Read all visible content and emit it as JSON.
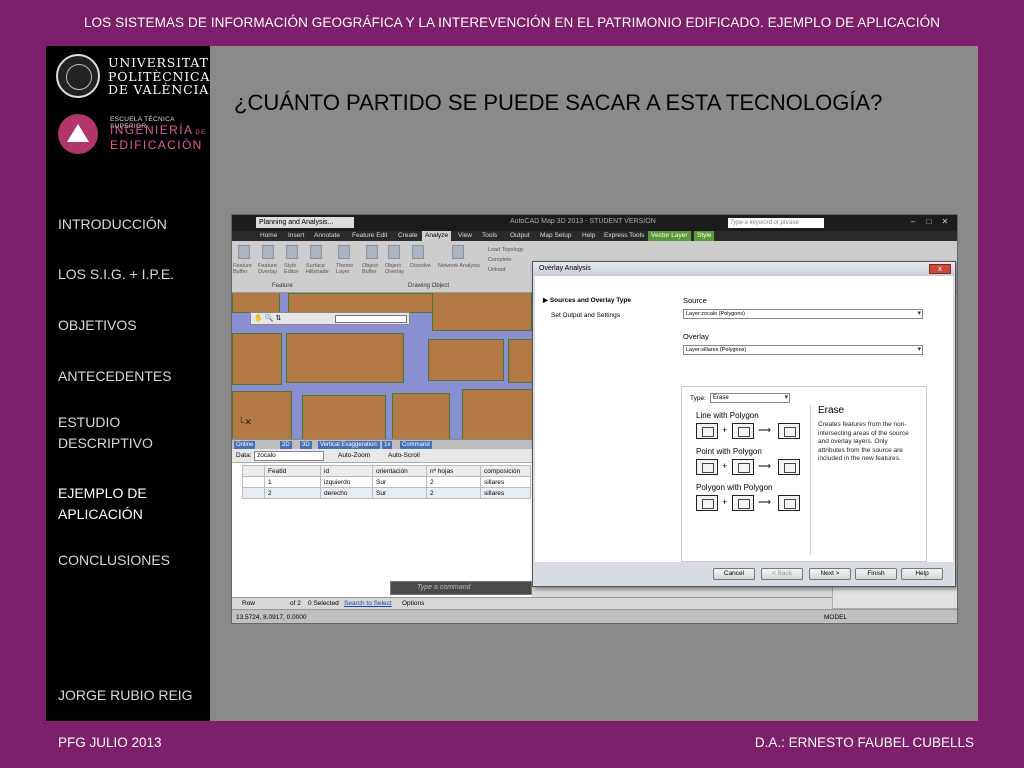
{
  "header": {
    "title": "LOS SISTEMAS DE INFORMACIÓN GEOGRÁFICA Y LA INTEREVENCIÓN EN EL PATRIMONIO EDIFICADO. EJEMPLO DE APLICACIÓN"
  },
  "footer": {
    "left": "PFG JULIO 2013",
    "right": "D.A.: ERNESTO FAUBEL CUBELLS"
  },
  "logos": {
    "university": [
      "UNIVERSITAT",
      "POLITÈCNICA",
      "DE VALÈNCIA"
    ],
    "school_small": "ESCUELA TÉCNICA SUPERIOR",
    "school_big": [
      "INGENIERÍA",
      "EDIFICACIÓN"
    ],
    "school_de": "DE"
  },
  "nav": {
    "items": [
      {
        "label": "INTRODUCCIÓN"
      },
      {
        "label": "LOS S.I.G. + I.P.E."
      },
      {
        "label": "OBJETIVOS"
      },
      {
        "label": "ANTECEDENTES"
      },
      {
        "label": "ESTUDIO DESCRIPTIVO"
      },
      {
        "label": "EJEMPLO DE APLICACIÓN"
      },
      {
        "label": "CONCLUSIONES"
      }
    ],
    "active_index": 5
  },
  "author": "JORGE RUBIO REIG",
  "slide": {
    "title": "¿CUÁNTO PARTIDO SE PUEDE SACAR A ESTA TECNOLOGÍA?"
  },
  "app": {
    "workspace": "Planning and Analysis...",
    "title": "AutoCAD Map 3D 2013 - STUDENT VERSION",
    "search_placeholder": "Type a keyword or phrase",
    "tabs": [
      "Home",
      "Insert",
      "Annotate",
      "Feature Edit",
      "Create",
      "Analyze",
      "View",
      "Tools",
      "Output",
      "Map Setup",
      "Help",
      "Express Tools",
      "Vector Layer",
      "Style"
    ],
    "active_tab": "Analyze",
    "ribbon_groups": {
      "feature": "Feature",
      "drawing_object": "Drawing Object"
    },
    "ribbon_tools": [
      "Feature Buffer",
      "Feature Overlay",
      "Style Editor",
      "Surface Hillshade",
      "Theme Layer",
      "Object Buffer",
      "Object Overlay",
      "Dissolve",
      "Network Analysis"
    ],
    "topology": [
      "Load Topology",
      "Complete",
      "Unload"
    ],
    "status_tabs": [
      "Online",
      "2D",
      "3D",
      "Vertical Exaggeration:",
      "1x",
      "Command"
    ],
    "data_label": "Data:",
    "data_value": "zocalo",
    "auto_zoom": "Auto-Zoom",
    "auto_scroll": "Auto-Scroll",
    "table": {
      "columns": [
        "",
        "FeatId",
        "id",
        "orientación",
        "nº hojas",
        "composición"
      ],
      "rows": [
        [
          "",
          "1",
          "izquierdo",
          "Sur",
          "2",
          "sillares"
        ],
        [
          "",
          "2",
          "derecho",
          "Sur",
          "2",
          "sillares"
        ]
      ]
    },
    "command_placeholder": "Type a command",
    "table_status": {
      "row": "Row",
      "of": "of 2",
      "selected": "0 Selected",
      "search": "Search to Select",
      "options": "Options"
    },
    "coords": "13.5724, 8.0917, 0.0000",
    "model": "MODEL"
  },
  "dialog": {
    "title": "Overlay Analysis",
    "close": "x",
    "steps": [
      "Sources and Overlay Type",
      "Set Output and Settings"
    ],
    "source_label": "Source",
    "source_value": "Layer:zocalo (Polygons)",
    "overlay_label": "Overlay",
    "overlay_value": "Layer:sillares (Polygons)",
    "type_label": "Type:",
    "type_value": "Erase",
    "options": [
      "Line with Polygon",
      "Point with Polygon",
      "Polygon with Polygon"
    ],
    "plus": "+",
    "arrow": "⟶",
    "description_title": "Erase",
    "description": "Creates features from the non-intersecting areas of the source and overlay layers. Only attributes from the source are included in the new features.",
    "buttons": [
      "Cancel",
      "< Back",
      "Next >",
      "Finish",
      "Help"
    ]
  }
}
